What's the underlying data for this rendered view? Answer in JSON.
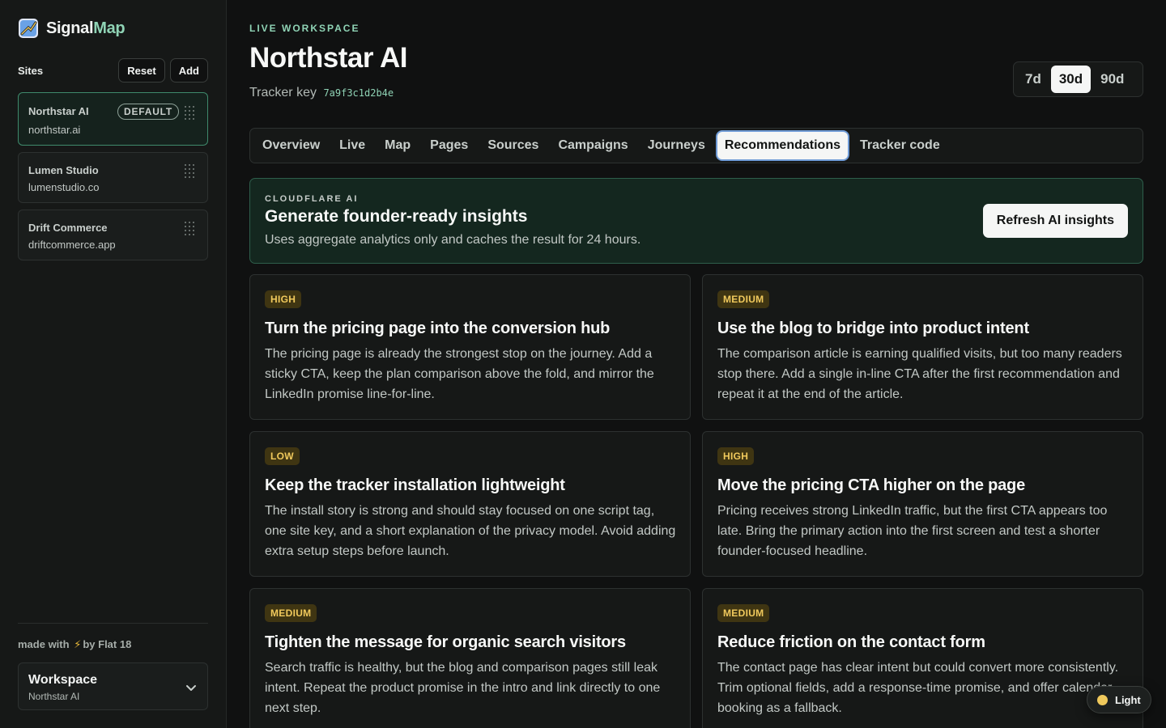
{
  "brand": {
    "name_part1": "Signal",
    "name_part2": "Map",
    "logo_icon": "signalmap-logo-icon"
  },
  "sidebar": {
    "sites_label": "Sites",
    "reset_label": "Reset",
    "add_label": "Add",
    "sites": [
      {
        "name": "Northstar AI",
        "domain": "northstar.ai",
        "badge": "DEFAULT",
        "active": true
      },
      {
        "name": "Lumen Studio",
        "domain": "lumenstudio.co"
      },
      {
        "name": "Drift Commerce",
        "domain": "driftcommerce.app"
      }
    ],
    "made_with_prefix": "made with",
    "made_with_icon": "⚡",
    "made_with_suffix": "by  Flat 18",
    "workspace": {
      "title": "Workspace",
      "subtitle": "Northstar AI"
    }
  },
  "header": {
    "eyebrow": "LIVE WORKSPACE",
    "title": "Northstar AI",
    "tracker_label": "Tracker key",
    "tracker_key": "7a9f3c1d2b4e",
    "ranges": [
      {
        "label": "7d",
        "active": false
      },
      {
        "label": "30d",
        "active": true
      },
      {
        "label": "90d",
        "active": false
      }
    ]
  },
  "tabs": [
    {
      "label": "Overview"
    },
    {
      "label": "Live"
    },
    {
      "label": "Map"
    },
    {
      "label": "Pages"
    },
    {
      "label": "Sources"
    },
    {
      "label": "Campaigns"
    },
    {
      "label": "Journeys"
    },
    {
      "label": "Recommendations",
      "active": true
    },
    {
      "label": "Tracker code"
    }
  ],
  "ai_banner": {
    "eyebrow": "CLOUDFLARE AI",
    "title": "Generate founder-ready insights",
    "description": "Uses aggregate analytics only and caches the result for 24 hours.",
    "button_label": "Refresh AI insights"
  },
  "recommendations": [
    {
      "priority": "HIGH",
      "title": "Turn the pricing page into the conversion hub",
      "body": "The pricing page is already the strongest stop on the journey. Add a sticky CTA, keep the plan comparison above the fold, and mirror the LinkedIn promise line-for-line."
    },
    {
      "priority": "MEDIUM",
      "title": "Use the blog to bridge into product intent",
      "body": "The comparison article is earning qualified visits, but too many readers stop there. Add a single in-line CTA after the first recommendation and repeat it at the end of the article."
    },
    {
      "priority": "LOW",
      "title": "Keep the tracker installation lightweight",
      "body": "The install story is strong and should stay focused on one script tag, one site key, and a short explanation of the privacy model. Avoid adding extra setup steps before launch."
    },
    {
      "priority": "HIGH",
      "title": "Move the pricing CTA higher on the page",
      "body": "Pricing receives strong LinkedIn traffic, but the first CTA appears too late. Bring the primary action into the first screen and test a shorter founder-focused headline."
    },
    {
      "priority": "MEDIUM",
      "title": "Tighten the message for organic search visitors",
      "body": "Search traffic is healthy, but the blog and comparison pages still leak intent. Repeat the product promise in the intro and link directly to one next step."
    },
    {
      "priority": "MEDIUM",
      "title": "Reduce friction on the contact form",
      "body": "The contact page has clear intent but could convert more consistently. Trim optional fields, add a response-time promise, and offer calendar booking as a fallback."
    }
  ],
  "theme_toggle": {
    "label": "Light"
  },
  "colors": {
    "accent": "#8fd3b5",
    "badge_text": "#f0c95c",
    "badge_bg": "#3f3512",
    "background": "#101111"
  }
}
